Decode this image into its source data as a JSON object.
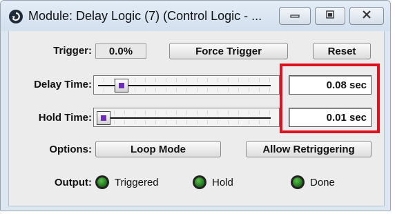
{
  "window": {
    "title": "Module: Delay Logic (7) (Control Logic - ...",
    "app_icon": "module-icon",
    "controls": [
      "minimize-icon",
      "maximize-icon",
      "close-icon"
    ]
  },
  "trigger": {
    "label": "Trigger:",
    "value": "0.0%",
    "force_label": "Force Trigger",
    "reset_label": "Reset"
  },
  "delay": {
    "label": "Delay Time:",
    "value": "0.08 sec",
    "slider_fraction": 0.11
  },
  "hold": {
    "label": "Hold Time:",
    "value": "0.01 sec",
    "slider_fraction": 0.0
  },
  "options": {
    "label": "Options:",
    "loop_label": "Loop Mode",
    "retrigger_label": "Allow Retriggering"
  },
  "output": {
    "label": "Output:",
    "leds": [
      {
        "label": "Triggered",
        "color": "#3fa53a"
      },
      {
        "label": "Hold",
        "color": "#3fa53a"
      },
      {
        "label": "Done",
        "color": "#3fa53a"
      }
    ]
  },
  "colors": {
    "highlight": "#e0101e",
    "thumb_accent": "#6e2fb8"
  }
}
